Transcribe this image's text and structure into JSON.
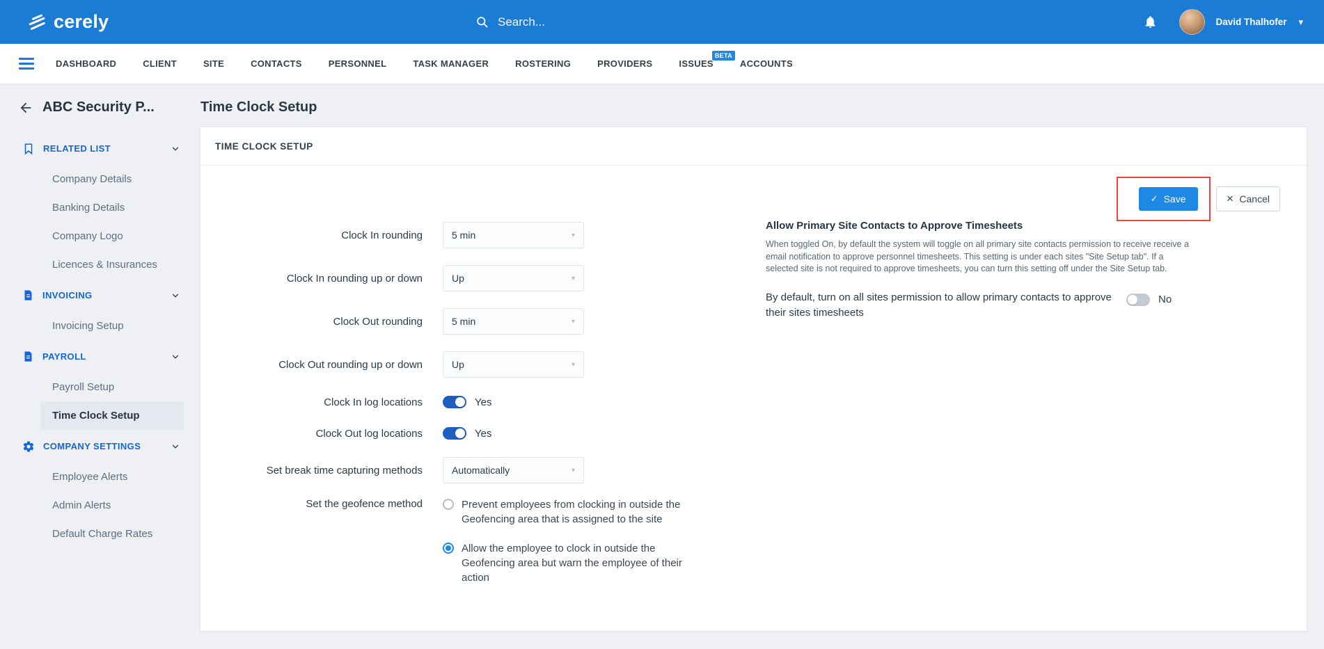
{
  "topbar": {
    "brand": "cerely",
    "search_placeholder": "Search...",
    "user_name": "David Thalhofer"
  },
  "nav": {
    "items": [
      "DASHBOARD",
      "CLIENT",
      "SITE",
      "CONTACTS",
      "PERSONNEL",
      "TASK MANAGER",
      "ROSTERING",
      "PROVIDERS",
      "ISSUES",
      "ACCOUNTS"
    ],
    "beta_badge": "BETA"
  },
  "sidebar": {
    "title": "ABC Security P...",
    "sections": [
      {
        "label": "RELATED LIST",
        "icon": "bookmark-icon",
        "items": [
          "Company Details",
          "Banking Details",
          "Company Logo",
          "Licences & Insurances"
        ]
      },
      {
        "label": "INVOICING",
        "icon": "document-icon",
        "items": [
          "Invoicing Setup"
        ]
      },
      {
        "label": "PAYROLL",
        "icon": "document-icon",
        "items": [
          "Payroll Setup",
          "Time Clock Setup"
        ]
      },
      {
        "label": "COMPANY SETTINGS",
        "icon": "gear-icon",
        "items": [
          "Employee Alerts",
          "Admin Alerts",
          "Default Charge Rates"
        ]
      }
    ],
    "selected_item": "Time Clock Setup"
  },
  "main": {
    "page_title": "Time Clock Setup",
    "card_title": "TIME CLOCK SETUP",
    "actions": {
      "save": "Save",
      "cancel": "Cancel"
    },
    "form": {
      "rows": [
        {
          "label": "Clock In rounding",
          "value": "5 min",
          "type": "select"
        },
        {
          "label": "Clock In rounding up or down",
          "value": "Up",
          "type": "select"
        },
        {
          "label": "Clock Out rounding",
          "value": "5 min",
          "type": "select"
        },
        {
          "label": "Clock Out rounding up or down",
          "value": "Up",
          "type": "select"
        },
        {
          "label": "Clock In log locations",
          "value": "Yes",
          "type": "toggle",
          "state": "on"
        },
        {
          "label": "Clock Out log locations",
          "value": "Yes",
          "type": "toggle",
          "state": "on"
        },
        {
          "label": "Set break time capturing methods",
          "value": "Automatically",
          "type": "select"
        },
        {
          "label": "Set the geofence method",
          "type": "radio-group"
        }
      ],
      "geofence_options": [
        {
          "label": "Prevent employees from clocking in outside the Geofencing area that is assigned to the site",
          "selected": false
        },
        {
          "label": "Allow the employee to clock in outside the Geofencing area but warn the employee of their action",
          "selected": true
        }
      ]
    },
    "approve_panel": {
      "heading": "Allow Primary Site Contacts to Approve Timesheets",
      "description": "When toggled On, by default the system will toggle on all primary site contacts permission to receive receive a email notification to approve personnel timesheets. This setting is under each sites \"Site Setup tab\". If a selected site is not required to approve timesheets, you can turn this setting off under the Site Setup tab.",
      "toggle_label": "By default, turn on all sites permission to allow primary contacts to approve their sites timesheets",
      "toggle_state": "No"
    }
  },
  "icons": {
    "check": "✓",
    "close": "✕",
    "caret_down": "▾",
    "select_caret": "▾"
  },
  "colors": {
    "topbar_blue": "#1b7cd6",
    "accent_blue": "#1e88e5",
    "section_blue": "#1565d8",
    "toggle_on_blue": "#1d5ec0",
    "annotation_red": "#e8453c"
  }
}
